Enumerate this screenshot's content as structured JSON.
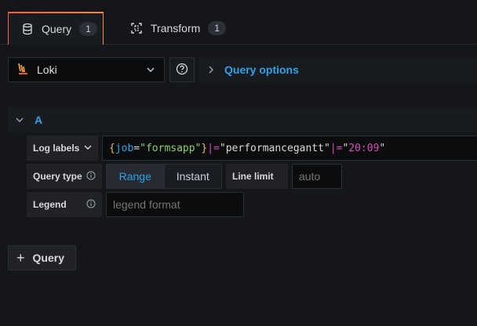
{
  "tabs": [
    {
      "label": "Query",
      "count": "1",
      "icon": "database-icon"
    },
    {
      "label": "Transform",
      "count": "1",
      "icon": "transform-icon"
    }
  ],
  "toolbar": {
    "datasource": "Loki",
    "query_options_label": "Query options"
  },
  "query": {
    "ref_id": "A",
    "log_labels_label": "Log labels",
    "expr": {
      "brace_open": "{",
      "key": "job",
      "eq": "=",
      "value": "\"formsapp\"",
      "brace_close": "}",
      "pipe1": "|=",
      "filter1": "\"performancegantt\"",
      "pipe2": "|=",
      "filter2_open": "\"",
      "filter2_time": "20:09",
      "filter2_close": "\""
    },
    "query_type_label": "Query type",
    "query_type_options": [
      "Range",
      "Instant"
    ],
    "line_limit_label": "Line limit",
    "line_limit_placeholder": "auto",
    "legend_label": "Legend",
    "legend_placeholder": "legend format"
  },
  "add_query_label": "Query",
  "colors": {
    "accent": "#33a2e5",
    "bg": "#141619",
    "tab_gradient": "#f55f3e"
  }
}
